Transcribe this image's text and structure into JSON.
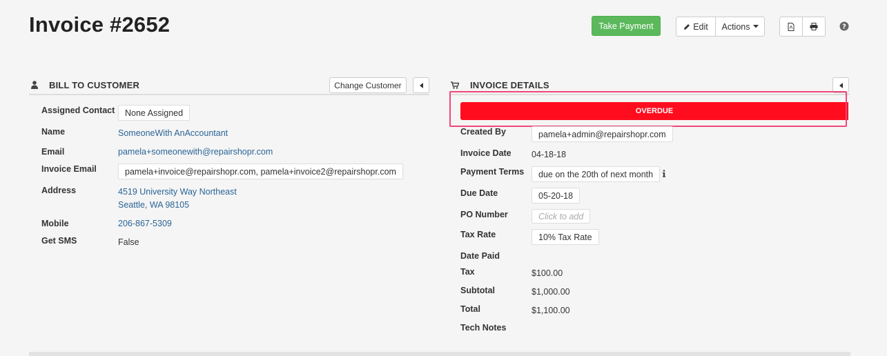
{
  "header": {
    "title": "Invoice #2652",
    "take_payment": "Take Payment",
    "edit": "Edit",
    "actions": "Actions"
  },
  "bill_to": {
    "heading": "BILL TO CUSTOMER",
    "change_customer": "Change Customer",
    "fields": {
      "assigned_contact": {
        "label": "Assigned Contact",
        "value": "None Assigned"
      },
      "name": {
        "label": "Name",
        "value": "SomeoneWith AnAccountant"
      },
      "email": {
        "label": "Email",
        "value": "pamela+someonewith@repairshopr.com"
      },
      "invoice_email": {
        "label": "Invoice Email",
        "value": "pamela+invoice@repairshopr.com, pamela+invoice2@repairshopr.com"
      },
      "address": {
        "label": "Address",
        "line1": "4519 University Way Northeast",
        "line2": "Seattle, WA 98105"
      },
      "mobile": {
        "label": "Mobile",
        "value": "206-867-5309"
      },
      "get_sms": {
        "label": "Get SMS",
        "value": "False"
      }
    }
  },
  "invoice_details": {
    "heading": "INVOICE DETAILS",
    "status": "OVERDUE",
    "status_color": "#ff0d1e",
    "fields": {
      "created_by": {
        "label": "Created By",
        "value": "pamela+admin@repairshopr.com"
      },
      "invoice_date": {
        "label": "Invoice Date",
        "value": "04-18-18"
      },
      "payment_terms": {
        "label": "Payment Terms",
        "value": "due on the 20th of next month"
      },
      "due_date": {
        "label": "Due Date",
        "value": "05-20-18"
      },
      "po_number": {
        "label": "PO Number",
        "placeholder": "Click to add"
      },
      "tax_rate": {
        "label": "Tax Rate",
        "value": "10% Tax Rate"
      },
      "date_paid": {
        "label": "Date Paid"
      },
      "tax": {
        "label": "Tax",
        "value": "$100.00"
      },
      "subtotal": {
        "label": "Subtotal",
        "value": "$1,000.00"
      },
      "total": {
        "label": "Total",
        "value": "$1,100.00"
      },
      "tech_notes": {
        "label": "Tech Notes"
      }
    }
  },
  "colors": {
    "accent_green": "#5cb85c",
    "link": "#2a6496",
    "highlight": "#f0467a"
  }
}
